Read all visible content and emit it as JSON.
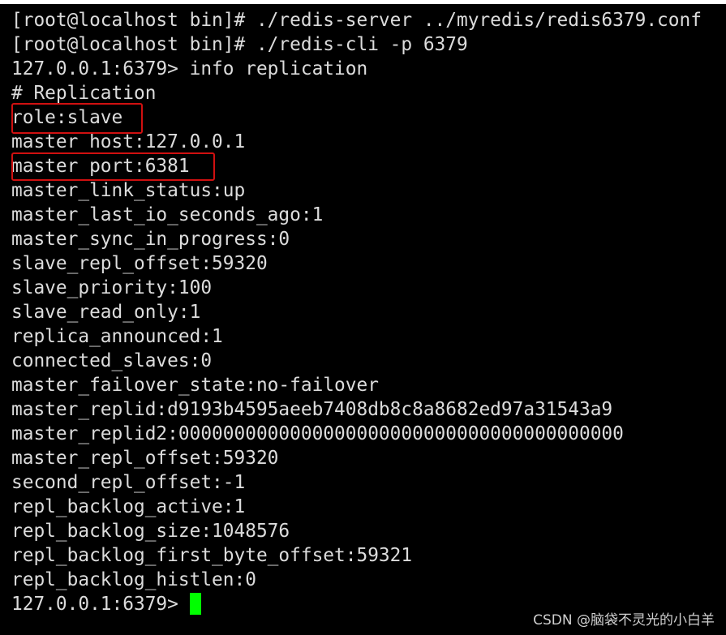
{
  "terminal": {
    "lines": [
      "[root@localhost bin]# ./redis-server ../myredis/redis6379.conf",
      "[root@localhost bin]# ./redis-cli -p 6379",
      "127.0.0.1:6379> info replication",
      "# Replication",
      "role:slave",
      "master host:127.0.0.1",
      "master port:6381",
      "master_link_status:up",
      "master_last_io_seconds_ago:1",
      "master_sync_in_progress:0",
      "slave_repl_offset:59320",
      "slave_priority:100",
      "slave_read_only:1",
      "replica_announced:1",
      "connected_slaves:0",
      "master_failover_state:no-failover",
      "master_replid:d9193b4595aeeb7408db8c8a8682ed97a31543a9",
      "master_replid2:0000000000000000000000000000000000000000",
      "master_repl_offset:59320",
      "second_repl_offset:-1",
      "repl_backlog_active:1",
      "repl_backlog_size:1048576",
      "repl_backlog_first_byte_offset:59321",
      "repl_backlog_histlen:0"
    ],
    "prompt": "127.0.0.1:6379> "
  },
  "colors": {
    "background": "#000000",
    "text": "#dcdcdc",
    "highlight": "#d01010",
    "cursor": "#00ff00"
  },
  "watermark": "CSDN @脑袋不灵光的小白羊"
}
